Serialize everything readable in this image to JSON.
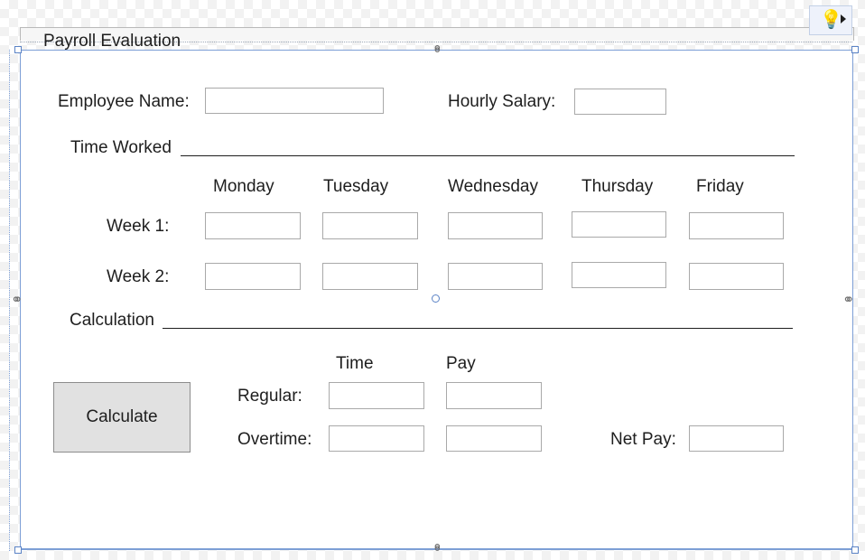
{
  "window": {
    "title": "Payroll Evaluation"
  },
  "employee": {
    "name_label": "Employee Name:",
    "name_value": "",
    "salary_label": "Hourly Salary:",
    "salary_value": ""
  },
  "time_worked": {
    "heading": "Time Worked",
    "days": [
      "Monday",
      "Tuesday",
      "Wednesday",
      "Thursday",
      "Friday"
    ],
    "weeks": [
      {
        "label": "Week 1:",
        "values": [
          "",
          "",
          "",
          "",
          ""
        ]
      },
      {
        "label": "Week 2:",
        "values": [
          "",
          "",
          "",
          "",
          ""
        ]
      }
    ]
  },
  "calculation": {
    "heading": "Calculation",
    "col_time": "Time",
    "col_pay": "Pay",
    "regular_label": "Regular:",
    "regular_time": "",
    "regular_pay": "",
    "overtime_label": "Overtime:",
    "overtime_time": "",
    "overtime_pay": "",
    "net_pay_label": "Net Pay:",
    "net_pay_value": "",
    "calculate_button": "Calculate"
  },
  "icons": {
    "hint": "lightbulb-icon",
    "hint_arrow": "triangle-right-icon",
    "anchor": "anchor-link-icon"
  },
  "colors": {
    "selection_border": "#7d9fd6",
    "bulb": "#f3c425",
    "button_face": "#e1e1e1"
  }
}
